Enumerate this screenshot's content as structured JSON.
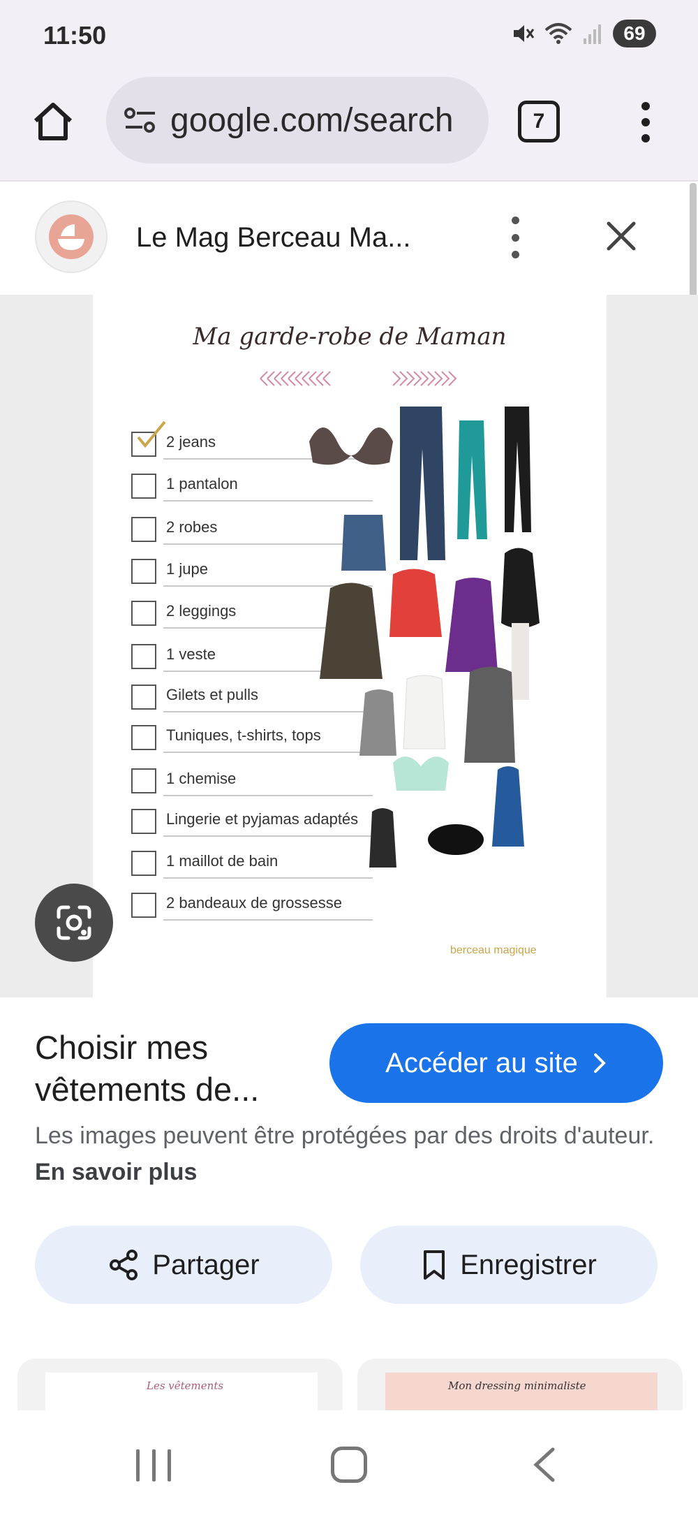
{
  "status_bar": {
    "time": "11:50",
    "battery": "69",
    "icons": [
      "mute-icon",
      "wifi-icon",
      "signal-icon",
      "battery-icon"
    ]
  },
  "browser": {
    "url": "google.com/search",
    "tab_count": "7"
  },
  "source": {
    "title": "Le Mag Berceau Ma..."
  },
  "image": {
    "title": "Ma garde-robe de Maman",
    "checklist": [
      {
        "label": "2 jeans",
        "checked": true
      },
      {
        "label": "1 pantalon",
        "checked": false
      },
      {
        "label": "2 robes",
        "checked": false
      },
      {
        "label": "1 jupe",
        "checked": false
      },
      {
        "label": "2 leggings",
        "checked": false
      },
      {
        "label": "1 veste",
        "checked": false
      },
      {
        "label": "Gilets et pulls",
        "checked": false
      },
      {
        "label": "Tuniques, t-shirts, tops",
        "checked": false
      },
      {
        "label": "1 chemise",
        "checked": false
      },
      {
        "label": "Lingerie et pyjamas adaptés",
        "checked": false
      },
      {
        "label": "1 maillot de bain",
        "checked": false
      },
      {
        "label": "2 bandeaux de grossesse",
        "checked": false
      }
    ],
    "logo_text": "berceau magique"
  },
  "info": {
    "title": "Choisir mes vêtements de...",
    "visit_label": "Accéder au site",
    "copyright_text": "Les images peuvent être protégées par des droits d'auteur.",
    "learn_more": "En savoir plus"
  },
  "actions": {
    "share_label": "Partager",
    "save_label": "Enregistrer"
  },
  "thumbnails": [
    {
      "caption": "Les vêtements"
    },
    {
      "caption": "Mon dressing minimaliste"
    }
  ],
  "colors": {
    "accent": "#1a73e8",
    "chip_bg": "#e8eefa",
    "toolbar_bg": "#f3eff6"
  }
}
